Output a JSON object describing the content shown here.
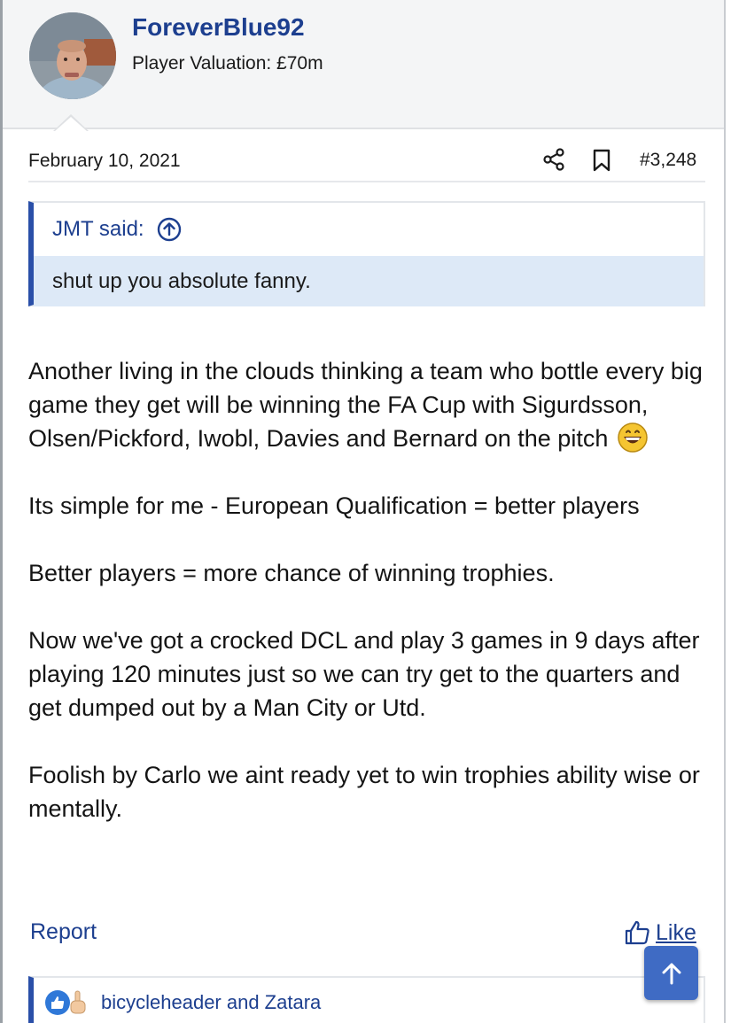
{
  "user": {
    "name": "ForeverBlue92",
    "title": "Player Valuation: £70m"
  },
  "post": {
    "date": "February 10, 2021",
    "number": "#3,248"
  },
  "quote": {
    "author_said": "JMT said:",
    "text": "shut up you absolute fanny."
  },
  "body": {
    "p1": "Another living in the clouds thinking a team who bottle every big game they get will be winning the FA Cup with Sigurdsson, Olsen/Pickford, Iwobl, Davies and Bernard on the pitch",
    "p2": "Its simple for me - European Qualification = better players",
    "p3": "Better players = more chance of winning trophies.",
    "p4": "Now we've got a crocked DCL and play 3 games in 9 days after playing 120 minutes just so we can try get to the quarters and get dumped out by a Man City or Utd.",
    "p5": "Foolish by Carlo we aint ready yet to win trophies ability wise or mentally."
  },
  "footer": {
    "report_label": "Report",
    "like_label": "Like"
  },
  "reactions": {
    "users": "bicycleheader and Zatara"
  },
  "icons": {
    "share": "share-icon",
    "bookmark": "bookmark-icon",
    "quote_jump": "arrow-up-circle-icon",
    "emoji": "grinning-emoji-icon",
    "like": "thumbs-up-icon",
    "scroll_top": "arrow-up-icon"
  },
  "colors": {
    "link": "#1d3f8f",
    "quote_accent": "#2a4fa8",
    "quote_body_bg": "#dde9f7",
    "scroll_button": "#3f6bc4"
  }
}
